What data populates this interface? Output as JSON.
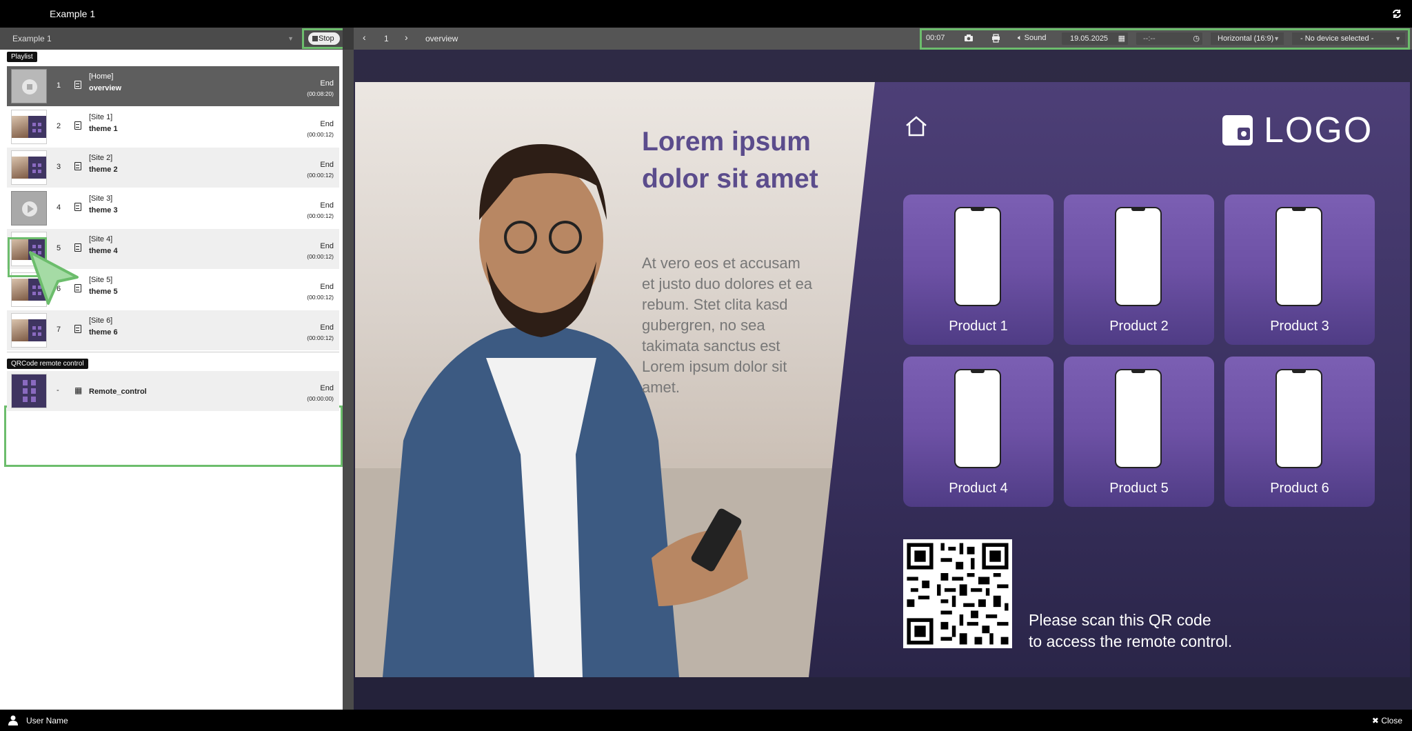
{
  "window": {
    "title": "Example 1"
  },
  "toolbar": {
    "playlist_name": "Example 1",
    "stop_label": "Stop",
    "page_number": "1",
    "page_name": "overview",
    "timer": "00:07",
    "sound_label": "Sound",
    "date": "19.05.2025",
    "time": "--:--",
    "orientation": "Horizontal (16:9)",
    "device": "- No device selected -"
  },
  "panel": {
    "playlist_tag": "Playlist",
    "qr_tag": "QRCode remote control",
    "items": [
      {
        "num": "1",
        "site": "[Home]",
        "name": "overview",
        "end": "End",
        "duration": "(00:08:20)"
      },
      {
        "num": "2",
        "site": "[Site 1]",
        "name": "theme 1",
        "end": "End",
        "duration": "(00:00:12)"
      },
      {
        "num": "3",
        "site": "[Site 2]",
        "name": "theme 2",
        "end": "End",
        "duration": "(00:00:12)"
      },
      {
        "num": "4",
        "site": "[Site 3]",
        "name": "theme 3",
        "end": "End",
        "duration": "(00:00:12)"
      },
      {
        "num": "5",
        "site": "[Site 4]",
        "name": "theme 4",
        "end": "End",
        "duration": "(00:00:12)"
      },
      {
        "num": "6",
        "site": "[Site 5]",
        "name": "theme 5",
        "end": "End",
        "duration": "(00:00:12)"
      },
      {
        "num": "7",
        "site": "[Site 6]",
        "name": "theme 6",
        "end": "End",
        "duration": "(00:00:12)"
      }
    ],
    "remote": {
      "num": "-",
      "name": "Remote_control",
      "end": "End",
      "duration": "(00:00:00)"
    }
  },
  "slide": {
    "headline": "Lorem ipsum dolor sit amet",
    "body": "At vero eos et accusam et justo duo dolores et ea rebum. Stet clita kasd gubergren, no sea takimata sanctus est Lorem ipsum dolor sit amet.",
    "logo": "LOGO",
    "products": [
      "Product 1",
      "Product 2",
      "Product 3",
      "Product 4",
      "Product 5",
      "Product 6"
    ],
    "scan_line1": "Please scan this QR code",
    "scan_line2": "to access the remote control."
  },
  "status": {
    "user": "User Name",
    "close": "Close"
  },
  "colors": {
    "accent_green": "#6cbd6c",
    "slide_purple": "#4d3f77",
    "headline_purple": "#5b4c8c"
  }
}
